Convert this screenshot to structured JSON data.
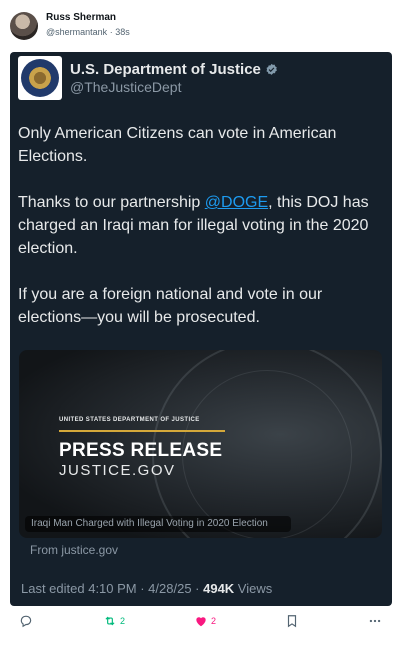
{
  "author": {
    "name": "Russ Sherman",
    "handle": "@shermantank",
    "separator": "·",
    "time": "38s"
  },
  "quoted": {
    "name": "U.S. Department of Justice",
    "handle": "@TheJusticeDept",
    "text_1": "Only American Citizens can vote in American Elections.",
    "text_2_pre": "Thanks to our partnership ",
    "text_2_mention": "@DOGE",
    "text_2_post": ", this DOJ has charged an Iraqi man for illegal voting in the 2020 election.",
    "text_3": "If you are a foreign national and vote in our elections—you will be prosecuted.",
    "media": {
      "kicker": "UNITED STATES DEPARTMENT OF JUSTICE",
      "title": "PRESS RELEASE",
      "site": "JUSTICE.GOV",
      "caption": "Iraqi Man Charged with Illegal Voting in 2020 Election"
    },
    "from_link": "From justice.gov",
    "edited": "Last edited 4:10 PM · 4/28/25 · ",
    "views_count": "494K",
    "views_label": " Views"
  },
  "actions": {
    "reposts": "2",
    "likes": "2"
  },
  "colors": {
    "accent": "#1d9bf0",
    "repost": "#00ba7c",
    "like": "#f91880",
    "card_bg": "#15202b"
  },
  "icons": [
    "reply-icon",
    "repost-icon",
    "like-icon",
    "bookmark-icon",
    "more-icon",
    "verified-icon"
  ]
}
